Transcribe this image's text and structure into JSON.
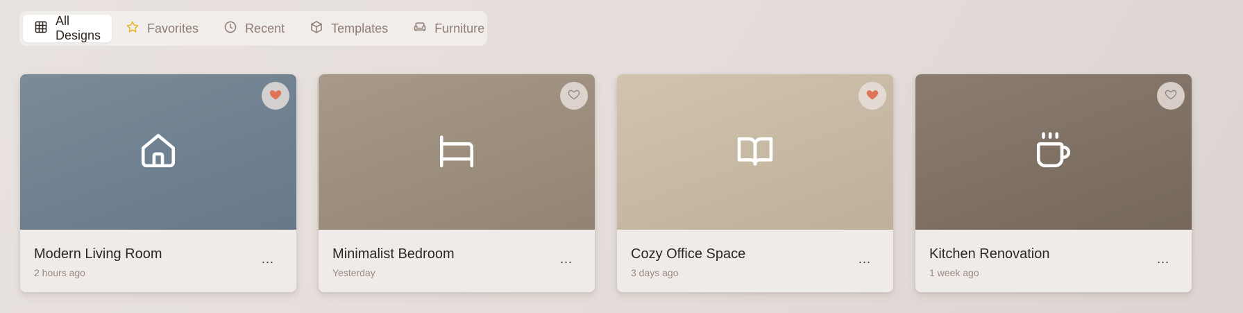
{
  "tabs": [
    {
      "label": "All Designs",
      "icon": "grid-icon",
      "active": true
    },
    {
      "label": "Favorites",
      "icon": "star-icon",
      "active": false
    },
    {
      "label": "Recent",
      "icon": "clock-icon",
      "active": false
    },
    {
      "label": "Templates",
      "icon": "cube-icon",
      "active": false
    },
    {
      "label": "Furniture",
      "icon": "sofa-icon",
      "active": false
    }
  ],
  "colors": {
    "star": "#e8b423",
    "heart_active": "#e07256",
    "heart_inactive": "#8e8580",
    "card_gradients": [
      [
        "#7a8c98",
        "#66788a"
      ],
      [
        "#a89a88",
        "#928472"
      ],
      [
        "#d0c4ae",
        "#beb09a"
      ],
      [
        "#8a7c70",
        "#75685b"
      ]
    ]
  },
  "cards": [
    {
      "title": "Modern Living Room",
      "time": "2 hours ago",
      "icon": "home-icon",
      "favorite": true,
      "more": "..."
    },
    {
      "title": "Minimalist Bedroom",
      "time": "Yesterday",
      "icon": "bed-icon",
      "favorite": false,
      "more": "..."
    },
    {
      "title": "Cozy Office Space",
      "time": "3 days ago",
      "icon": "book-open-icon",
      "favorite": true,
      "more": "..."
    },
    {
      "title": "Kitchen Renovation",
      "time": "1 week ago",
      "icon": "coffee-icon",
      "favorite": false,
      "more": "..."
    }
  ]
}
